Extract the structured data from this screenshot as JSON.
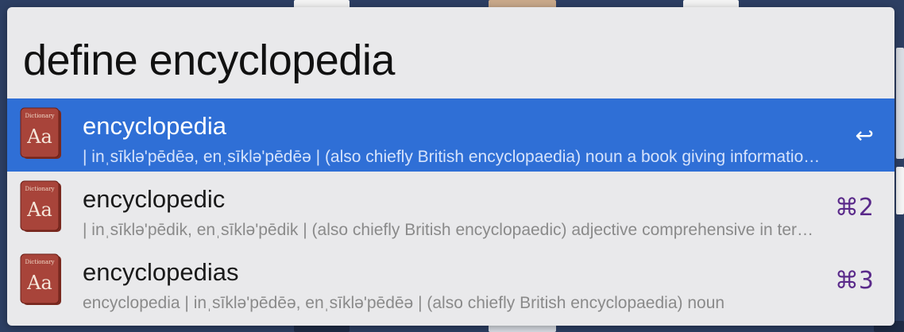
{
  "search": {
    "query": "define encyclopedia"
  },
  "results": [
    {
      "title": "encyclopedia",
      "subtitle": "| inˌsīklə'pēdēə, enˌsīklə'pēdēə | (also chiefly British encyclopaedia) noun a book giving information on many subjects",
      "shortcut": "↩"
    },
    {
      "title": "encyclopedic",
      "subtitle": "| inˌsīklə'pēdik, enˌsīklə'pēdik | (also chiefly British encyclopaedic) adjective comprehensive in terms of information",
      "shortcut": "⌘2"
    },
    {
      "title": "encyclopedias",
      "subtitle": "encyclopedia | inˌsīklə'pēdēə, enˌsīklə'pēdēə | (also chiefly British encyclopaedia) noun",
      "shortcut": "⌘3"
    }
  ],
  "icon": {
    "name": "dictionary-icon",
    "label_top": "Dictionary",
    "label_main": "Aa"
  },
  "colors": {
    "selected": "#2f6fd6",
    "panel": "#e9e9eb",
    "shortcut": "#5a2a8a"
  }
}
